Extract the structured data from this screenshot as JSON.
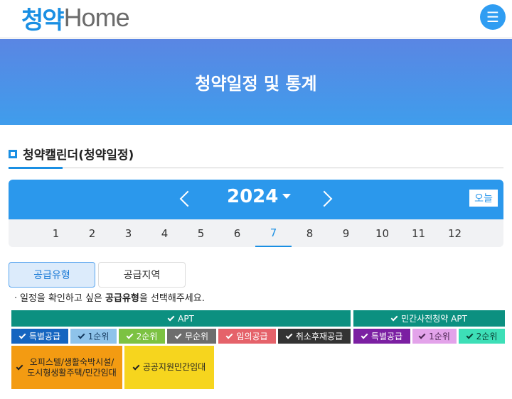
{
  "header": {
    "logo_kr": "청약",
    "logo_en": "Home",
    "menu_icon": "hamburger-icon"
  },
  "banner": {
    "title": "청약일정 및 통계"
  },
  "section": {
    "title": "청약캘린더(청약일정)"
  },
  "calendar": {
    "year": "2024",
    "today_label": "오늘",
    "months": [
      "1",
      "2",
      "3",
      "4",
      "5",
      "6",
      "7",
      "8",
      "9",
      "10",
      "11",
      "12"
    ],
    "selected_month": "7"
  },
  "tabs": {
    "supply_type": "공급유형",
    "supply_region": "공급지역"
  },
  "guide": {
    "prefix": "ㆍ일정을 확인하고 싶은 ",
    "bold": "공급유형",
    "suffix": "을 선택해주세요."
  },
  "filters": {
    "apt": "APT",
    "private_pre": "민간사전청약 APT",
    "chips": [
      {
        "label": "특별공급",
        "color": "#1565c0"
      },
      {
        "label": "1순위",
        "color": "#8ec3ea"
      },
      {
        "label": "2순위",
        "color": "#7cc242"
      },
      {
        "label": "무순위",
        "color": "#6d6d6d"
      },
      {
        "label": "임의공급",
        "color": "#e5626a"
      },
      {
        "label": "취소후재공급",
        "color": "#333333"
      },
      {
        "label": "특별공급",
        "color": "#7b1fa2"
      },
      {
        "label": "1순위",
        "color": "#e3a3ea"
      },
      {
        "label": "2순위",
        "color": "#3ddfb7"
      }
    ],
    "officetel": "오피스텔/생활숙박시설/도시형생활주택/민간임대",
    "public_support": "공공지원민간임대"
  },
  "colors": {
    "accent": "#1a8fe3",
    "apt_bar": "#0c9080",
    "officetel": "#f39b12",
    "public_support": "#f6d51e"
  }
}
